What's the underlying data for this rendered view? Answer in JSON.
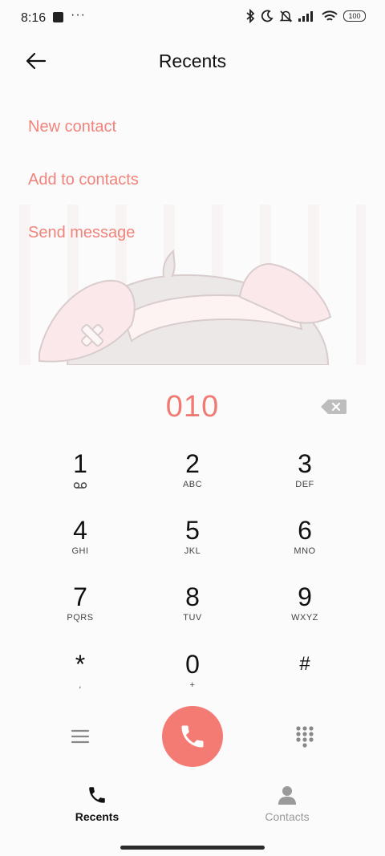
{
  "status_bar": {
    "time": "8:16",
    "dots": "···",
    "battery": "100"
  },
  "header": {
    "title": "Recents",
    "back_icon": "arrow-left-icon"
  },
  "options": {
    "new_contact": "New contact",
    "add_to_contacts": "Add to contacts",
    "send_message": "Send message"
  },
  "dialer": {
    "number": "010",
    "keys": [
      {
        "digit": "1",
        "letters": ""
      },
      {
        "digit": "2",
        "letters": "ABC"
      },
      {
        "digit": "3",
        "letters": "DEF"
      },
      {
        "digit": "4",
        "letters": "GHI"
      },
      {
        "digit": "5",
        "letters": "JKL"
      },
      {
        "digit": "6",
        "letters": "MNO"
      },
      {
        "digit": "7",
        "letters": "PQRS"
      },
      {
        "digit": "8",
        "letters": "TUV"
      },
      {
        "digit": "9",
        "letters": "WXYZ"
      },
      {
        "digit": "*",
        "letters": ","
      },
      {
        "digit": "0",
        "letters": "+"
      },
      {
        "digit": "#",
        "letters": ""
      }
    ]
  },
  "bottom_nav": {
    "recents": "Recents",
    "contacts": "Contacts"
  },
  "colors": {
    "accent": "#f47b74",
    "option_text": "#f0837b"
  }
}
